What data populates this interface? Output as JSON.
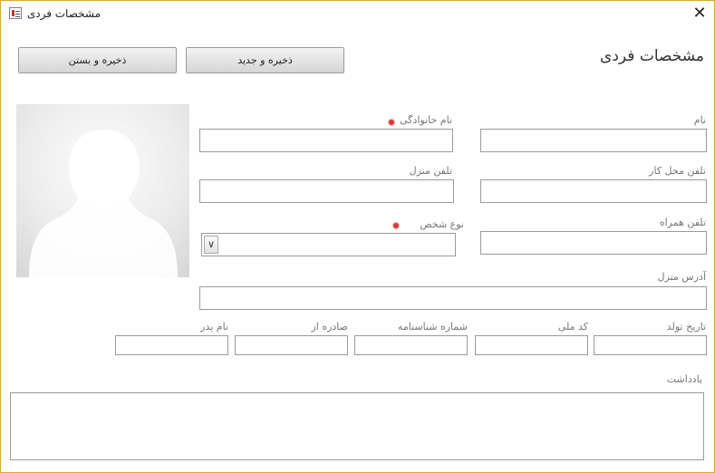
{
  "window": {
    "title": "مشخصات  فردی",
    "close_glyph": "✕"
  },
  "form": {
    "title": "مشخصات فردی"
  },
  "buttons": {
    "save_close": "ذخیره و بستن",
    "save_new": "ذخیره و جدید"
  },
  "fields": {
    "first_name": "نام",
    "last_name": "نام خانوادگی",
    "work_phone": "تلفن محل کار",
    "home_phone": "تلفن منزل",
    "mobile": "تلفن همراه",
    "person_type": "نوع شخص",
    "home_address": "آدرس منزل",
    "birth_date": "تاریخ تولد",
    "national_code": "کد ملی",
    "id_number": "شماره شناسنامه",
    "issued_from": "صادره از",
    "father_name": "نام پدر",
    "notes": "یادداشت"
  },
  "icons": {
    "app": "form-icon",
    "close": "close-icon",
    "required": "required-marker-icon",
    "dropdown": "chevron-down-icon",
    "photo": "person-silhouette-icon"
  },
  "colors": {
    "window_border": "#e0a43a",
    "required_marker": "#d63a3a",
    "button_top": "#f3f3f3",
    "button_bottom": "#d5d5d5"
  }
}
